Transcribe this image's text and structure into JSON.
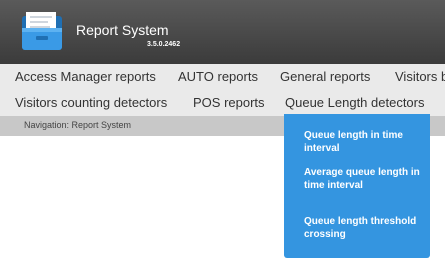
{
  "header": {
    "app_title": "Report System",
    "version": "3.5.0.2462",
    "logo_icon": "folder-icon",
    "background_color": "#454545"
  },
  "menu": {
    "row1": [
      "Access Manager reports",
      "AUTO reports",
      "General reports",
      "Visitors b"
    ],
    "row2": [
      "Visitors counting detectors",
      "POS reports",
      "Queue Length detectors"
    ],
    "active_item": "Queue Length detectors",
    "accent_color": "#3495e0"
  },
  "navigation": {
    "text": "Navigation: Report System"
  },
  "dropdown": {
    "items": [
      "Queue length in time interval",
      "Average queue length in time interval",
      "Queue length threshold crossing"
    ]
  }
}
